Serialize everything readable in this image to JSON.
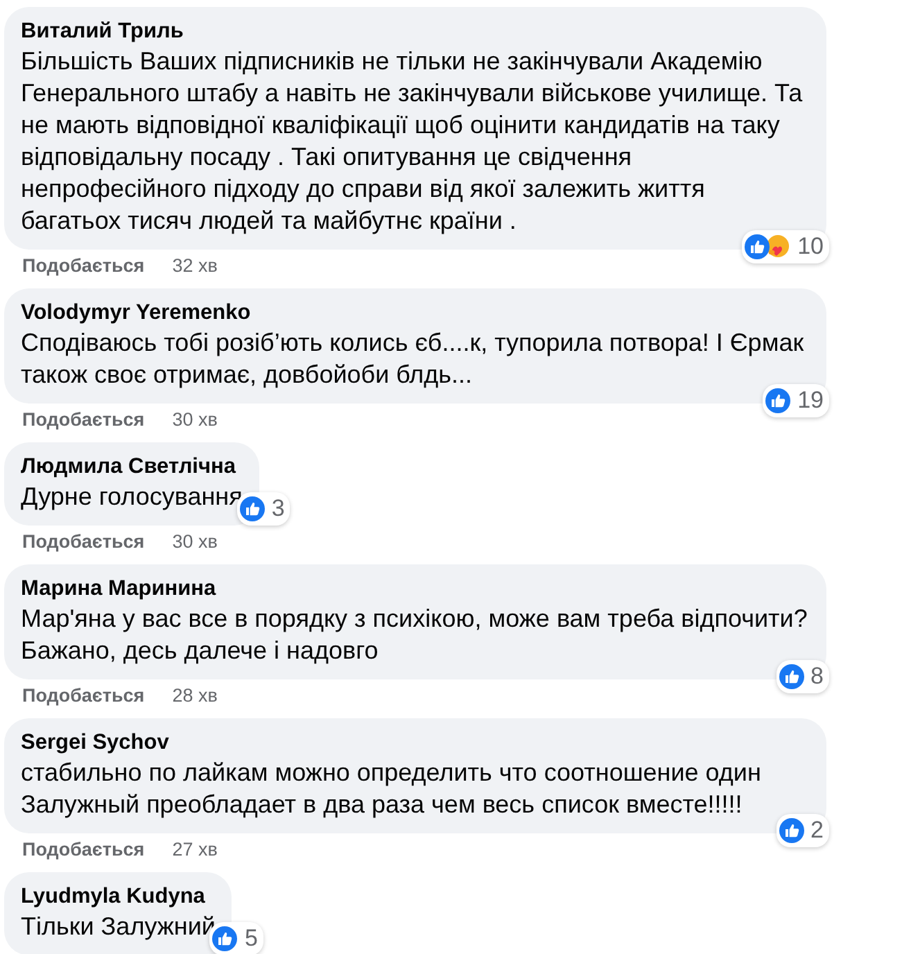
{
  "comments": [
    {
      "author": "Виталий Триль",
      "text": "Більшість Ваших підписників не тільки не закінчували Академію Генерального штабу а навіть не закінчували військове училище. Та не мають відповідної кваліфікації щоб оцінити кандидатів на таку відповідальну посаду . Такі опитування це свідчення непрофесійного підходу до справи від якої залежить життя багатьох тисяч людей та майбутнє країни .",
      "kind": "wide",
      "reactions": [
        {
          "kind": "like"
        },
        {
          "kind": "care"
        }
      ],
      "reaction_count": "10",
      "like_label": "Подобається",
      "time": "32 хв"
    },
    {
      "author": "Volodymyr Yeremenko",
      "text": "Сподіваюсь тобі розіб’ють колись єб....к, тупорила потвора! І Єрмак також своє отримає, довбойоби блдь...",
      "kind": "wide",
      "reactions": [
        {
          "kind": "like"
        }
      ],
      "reaction_count": "19",
      "like_label": "Подобається",
      "time": "30 хв"
    },
    {
      "author": "Людмила Светлічна",
      "text": "Дурне голосування",
      "kind": "compact",
      "reactions": [
        {
          "kind": "like"
        }
      ],
      "reaction_count": "3",
      "like_label": "Подобається",
      "time": "30 хв"
    },
    {
      "author": "Марина Маринина",
      "text": "Мар'яна у вас все в порядку з психікою, може вам треба відпочити? Бажано, десь далече і надовго",
      "kind": "wide",
      "reactions": [
        {
          "kind": "like"
        }
      ],
      "reaction_count": "8",
      "like_label": "Подобається",
      "time": "28 хв"
    },
    {
      "author": "Sergei Sychov",
      "text": "стабильно по лайкам можно определить что соотношение один Залужный преобладает в два раза чем весь список вместе!!!!!",
      "kind": "wide",
      "reactions": [
        {
          "kind": "like"
        }
      ],
      "reaction_count": "2",
      "like_label": "Подобається",
      "time": "27 хв"
    },
    {
      "author": "Lyudmyla Kudyna",
      "text": "Тільки Залужний",
      "kind": "compact",
      "reactions": [
        {
          "kind": "like"
        }
      ],
      "reaction_count": "5"
    }
  ]
}
